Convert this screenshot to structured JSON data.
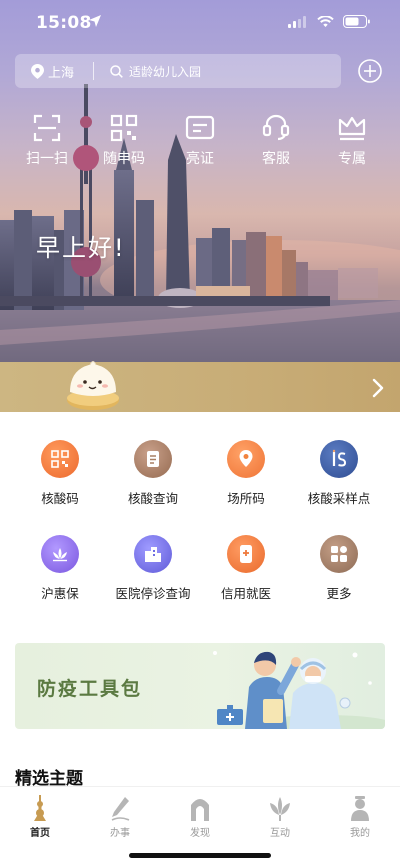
{
  "status_bar": {
    "time": "15:08"
  },
  "header": {
    "city": "上海",
    "search_placeholder": "适龄幼儿入园"
  },
  "quick_actions": [
    {
      "label": "扫一扫",
      "icon": "scan-icon"
    },
    {
      "label": "随申码",
      "icon": "qr-code-icon"
    },
    {
      "label": "亮证",
      "icon": "id-card-icon"
    },
    {
      "label": "客服",
      "icon": "customer-service-icon"
    },
    {
      "label": "专属",
      "icon": "crown-icon"
    }
  ],
  "greeting": "早上好!",
  "services": [
    {
      "label": "核酸码",
      "icon": "qr-code-icon",
      "color": "#f07a3e"
    },
    {
      "label": "核酸查询",
      "icon": "document-icon",
      "color": "#a97f63"
    },
    {
      "label": "场所码",
      "icon": "location-pin-icon",
      "color": "#f2833e"
    },
    {
      "label": "核酸采样点",
      "icon": "sampling-site-icon",
      "color": "#3f5fa8"
    },
    {
      "label": "沪惠保",
      "icon": "lotus-icon",
      "color": "#8e6fe0"
    },
    {
      "label": "医院停诊查询",
      "icon": "hospital-icon",
      "color": "#6e6de2"
    },
    {
      "label": "信用就医",
      "icon": "phone-medical-icon",
      "color": "#ef7a3c"
    },
    {
      "label": "更多",
      "icon": "more-grid-icon",
      "color": "#9a7a64"
    }
  ],
  "toolkit": {
    "title": "防疫工具包"
  },
  "section": {
    "title": "精选主题"
  },
  "tabs": [
    {
      "label": "首页",
      "icon": "home-tower-icon",
      "active": true
    },
    {
      "label": "办事",
      "icon": "pen-icon",
      "active": false
    },
    {
      "label": "发现",
      "icon": "arch-icon",
      "active": false
    },
    {
      "label": "互动",
      "icon": "magnolia-icon",
      "active": false
    },
    {
      "label": "我的",
      "icon": "person-icon",
      "active": false
    }
  ]
}
